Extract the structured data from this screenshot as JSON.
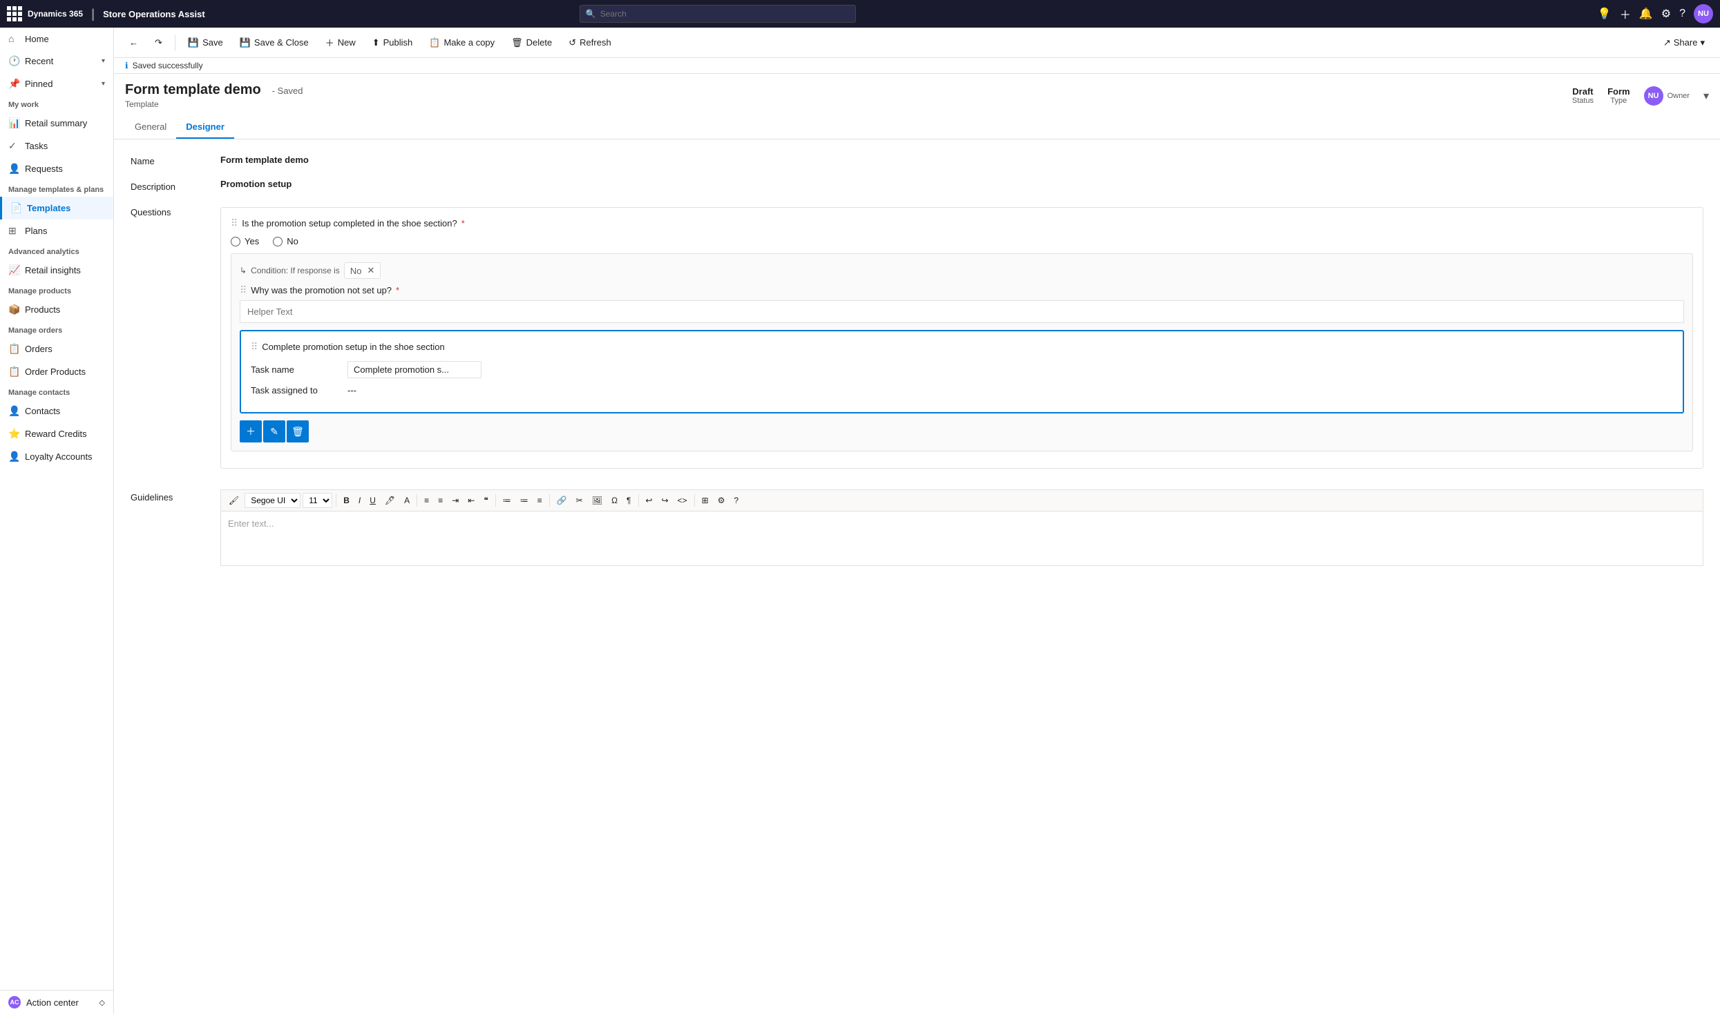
{
  "topbar": {
    "app_name": "Dynamics 365",
    "module_name": "Store Operations Assist",
    "search_placeholder": "Search"
  },
  "commands": {
    "back_label": "←",
    "refresh_label": "↺",
    "save_label": "Save",
    "save_close_label": "Save & Close",
    "new_label": "New",
    "publish_label": "Publish",
    "copy_label": "Make a copy",
    "delete_label": "Delete",
    "refresh_btn_label": "Refresh",
    "share_label": "Share"
  },
  "status_bar": {
    "message": "Saved successfully"
  },
  "form": {
    "title": "Form template demo",
    "saved_label": "- Saved",
    "subtitle": "Template",
    "status_label": "Status",
    "status_value": "Draft",
    "type_label": "Type",
    "type_value": "Form",
    "owner_label": "Owner",
    "owner_initials": "NU",
    "tabs": [
      "General",
      "Designer"
    ]
  },
  "fields": {
    "name_label": "Name",
    "name_value": "Form template demo",
    "description_label": "Description",
    "description_value": "Promotion setup",
    "questions_label": "Questions",
    "guidelines_label": "Guidelines"
  },
  "questions": [
    {
      "text": "Is the promotion setup completed in the shoe section?",
      "required": true,
      "type": "radio",
      "options": [
        "Yes",
        "No"
      ],
      "condition": {
        "label": "Condition: If response is",
        "value": "No"
      },
      "sub_questions": [
        {
          "text": "Why was the promotion not set up?",
          "required": true,
          "placeholder": "Helper Text"
        }
      ],
      "task": {
        "header": "Complete promotion setup in the shoe section",
        "task_name_label": "Task name",
        "task_name_value": "Complete promotion s...",
        "task_assigned_label": "Task assigned to",
        "task_assigned_value": "---"
      }
    }
  ],
  "guidelines": {
    "font_name": "Segoe UI",
    "font_size": "11",
    "placeholder": "Enter text..."
  },
  "sidebar": {
    "items": [
      {
        "label": "Home",
        "icon": "⌂",
        "section": null
      },
      {
        "label": "Recent",
        "icon": "🕐",
        "section": null,
        "expandable": true
      },
      {
        "label": "Pinned",
        "icon": "📌",
        "section": null,
        "expandable": true
      },
      {
        "label": "My work",
        "section_header": true
      },
      {
        "label": "Retail summary",
        "icon": "📊"
      },
      {
        "label": "Tasks",
        "icon": "✓"
      },
      {
        "label": "Requests",
        "icon": "👤"
      },
      {
        "label": "Manage templates & plans",
        "section_header": true
      },
      {
        "label": "Templates",
        "icon": "📄",
        "active": true
      },
      {
        "label": "Plans",
        "icon": "⊞"
      },
      {
        "label": "Advanced analytics",
        "section_header": true
      },
      {
        "label": "Retail insights",
        "icon": "📈"
      },
      {
        "label": "Manage products",
        "section_header": true
      },
      {
        "label": "Products",
        "icon": "📦"
      },
      {
        "label": "Manage orders",
        "section_header": true
      },
      {
        "label": "Orders",
        "icon": "📋"
      },
      {
        "label": "Order Products",
        "icon": "📋"
      },
      {
        "label": "Manage contacts",
        "section_header": true
      },
      {
        "label": "Contacts",
        "icon": "👤"
      },
      {
        "label": "Reward Credits",
        "icon": "⭐"
      },
      {
        "label": "Loyalty Accounts",
        "icon": "👤"
      },
      {
        "label": "AC Action center",
        "icon": "AC",
        "special": true
      }
    ]
  }
}
